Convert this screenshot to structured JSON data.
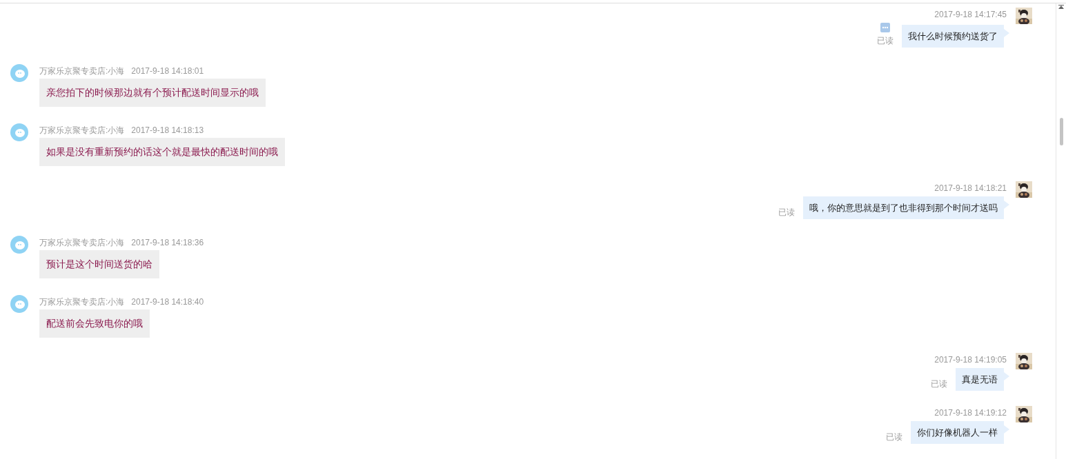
{
  "messages": [
    {
      "kind": "outgoing",
      "time": "2017-9-18 14:17:45",
      "text": "我什么时候预约送货了",
      "status": "已读",
      "has_menu": true
    },
    {
      "kind": "incoming",
      "sender": "万家乐京聚专卖店:小海",
      "time": "2017-9-18 14:18:01",
      "text": "亲您拍下的时候那边就有个预计配送时间显示的哦"
    },
    {
      "kind": "incoming",
      "sender": "万家乐京聚专卖店:小海",
      "time": "2017-9-18 14:18:13",
      "text": "如果是没有重新预约的话这个就是最快的配送时间的哦"
    },
    {
      "kind": "outgoing",
      "time": "2017-9-18 14:18:21",
      "text": "哦，你的意思就是到了也非得到那个时间才送吗",
      "status": "已读",
      "has_menu": false
    },
    {
      "kind": "incoming",
      "sender": "万家乐京聚专卖店:小海",
      "time": "2017-9-18 14:18:36",
      "text": "预计是这个时间送货的哈"
    },
    {
      "kind": "incoming",
      "sender": "万家乐京聚专卖店:小海",
      "time": "2017-9-18 14:18:40",
      "text": "配送前会先致电你的哦"
    },
    {
      "kind": "outgoing",
      "time": "2017-9-18 14:19:05",
      "text": "真是无语",
      "status": "已读",
      "has_menu": false
    },
    {
      "kind": "outgoing",
      "time": "2017-9-18 14:19:12",
      "text": "你们好像机器人一样",
      "status": "已读",
      "has_menu": false
    }
  ]
}
